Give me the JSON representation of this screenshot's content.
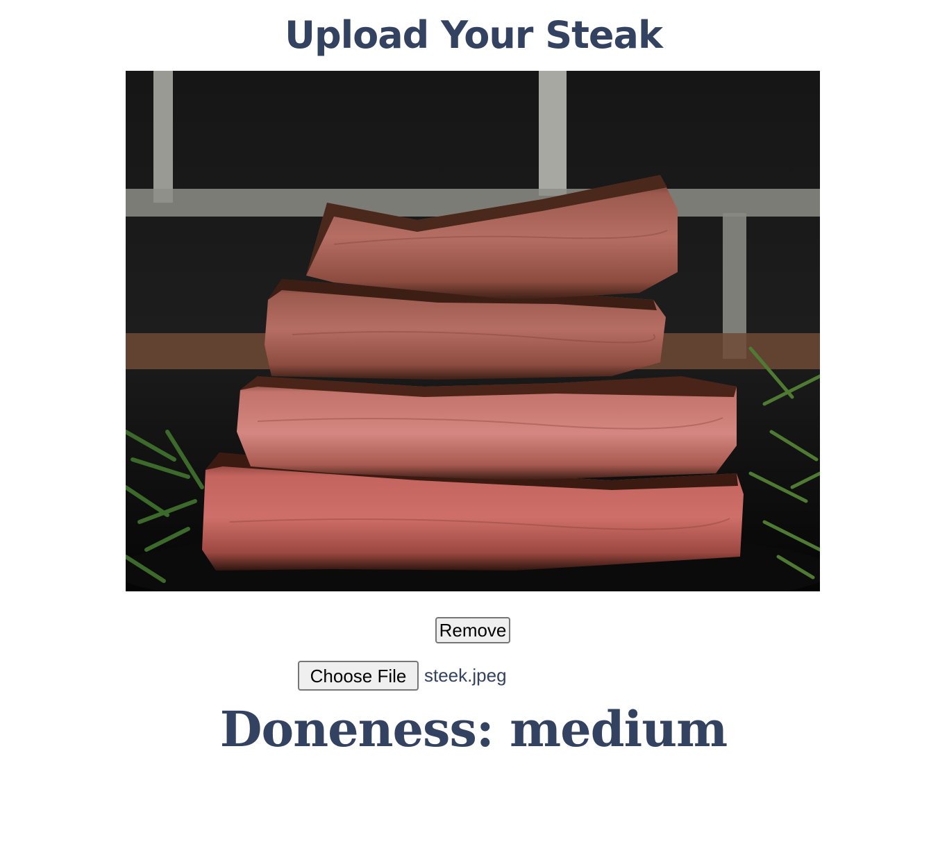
{
  "page": {
    "title": "Upload Your Steak"
  },
  "preview": {
    "alt": "Sliced steak stacked on a dark plate with fresh herbs"
  },
  "actions": {
    "remove_label": "Remove",
    "choose_file_label": "Choose File",
    "selected_file": "steek.jpeg"
  },
  "result": {
    "text": "Doneness: medium"
  },
  "colors": {
    "heading": "#334260",
    "button_bg": "#efefef",
    "button_border": "#767676"
  }
}
